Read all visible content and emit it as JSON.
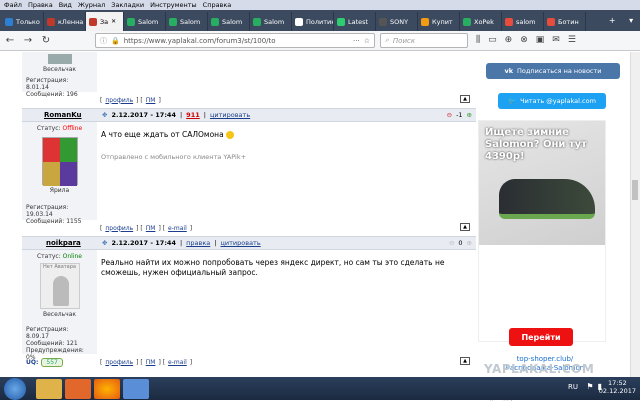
{
  "menu": [
    "Файл",
    "Правка",
    "Вид",
    "Журнал",
    "Закладки",
    "Инструменты",
    "Справка"
  ],
  "tabs": [
    {
      "label": "Только",
      "color": "#2d7fd3"
    },
    {
      "label": "кЛенна",
      "color": "#c0392b"
    },
    {
      "label": "За",
      "color": "#c0392b",
      "active": true
    },
    {
      "label": "Salom",
      "color": "#27ae60"
    },
    {
      "label": "Salom",
      "color": "#27ae60"
    },
    {
      "label": "Salom",
      "color": "#27ae60"
    },
    {
      "label": "Salom",
      "color": "#27ae60"
    },
    {
      "label": "Политика",
      "color": "#ffffff"
    },
    {
      "label": "Latest",
      "color": "#2ecc71"
    },
    {
      "label": "SONY",
      "color": "#555555"
    },
    {
      "label": "Купит",
      "color": "#f39c12"
    },
    {
      "label": "XoPek",
      "color": "#27ae60"
    },
    {
      "label": "salom",
      "color": "#e74c3c"
    },
    {
      "label": "Ботин",
      "color": "#e74c3c"
    }
  ],
  "nav": {
    "url": "https://www.yaplakal.com/forum3/st/100/to",
    "search_placeholder": "Поиск"
  },
  "posts": [
    {
      "user_title": "Весельчак",
      "reg": "Регистрация: 8.01.14",
      "msgs": "Сообщений: 196",
      "links": {
        "profile": "профиль",
        "pm": "ПМ"
      }
    },
    {
      "nick": "RomanKu",
      "status_label": "Статус:",
      "status": "Offline",
      "user_title": "Ярила",
      "date": "2.12.2017 - 17:44",
      "post_num": "911",
      "quote": "цитировать",
      "rating": "-1",
      "text": "А что еще ждать от САЛОмона",
      "signature": "Отправлено с мобильного клиента YAPik+",
      "reg": "Регистрация: 19.03.14",
      "msgs": "Сообщений: 1155",
      "links": {
        "profile": "профиль",
        "pm": "ПМ",
        "email": "e-mail"
      }
    },
    {
      "nick": "noikpara",
      "status_label": "Статус:",
      "status": "Online",
      "avatar_text": "Нет Аватара",
      "user_title": "Весельчак",
      "date": "2.12.2017 - 17:44",
      "edit": "правка",
      "quote": "цитировать",
      "rating": "0",
      "text": "Реально найти их можно попробовать через яндекс директ, но сам ты это сделать не сможешь, нужен официальный запрос.",
      "reg": "Регистрация: 8.09.17",
      "msgs": "Сообщений: 121",
      "warnings": "Предупреждения:",
      "warn_value": "0%",
      "uq_label": "UQ:",
      "uq": "557",
      "links": {
        "profile": "профиль",
        "pm": "ПМ",
        "email": "e-mail"
      }
    }
  ],
  "sidebar": {
    "vk_button": "Подписаться на новости",
    "tw_button": "Читать @yaplakal.com",
    "ad_title": "Ищете зимние Salomon? Они тут 4390р!",
    "ad_button": "Перейти",
    "ad_link": "top-shoper.club/Распродажа-Salomon",
    "ad_source": "Яндекс.Директ",
    "watermark": "YAPLAKAL.COM",
    "bottom_link": "Наверх"
  },
  "taskbar": {
    "lang": "RU",
    "time": "17:52",
    "date": "02.12.2017"
  },
  "colors": {
    "offline": "#ff0000",
    "online": "#008000",
    "accent": "#c00000",
    "vk": "#4a76a8",
    "twitter": "#1da1f2"
  }
}
